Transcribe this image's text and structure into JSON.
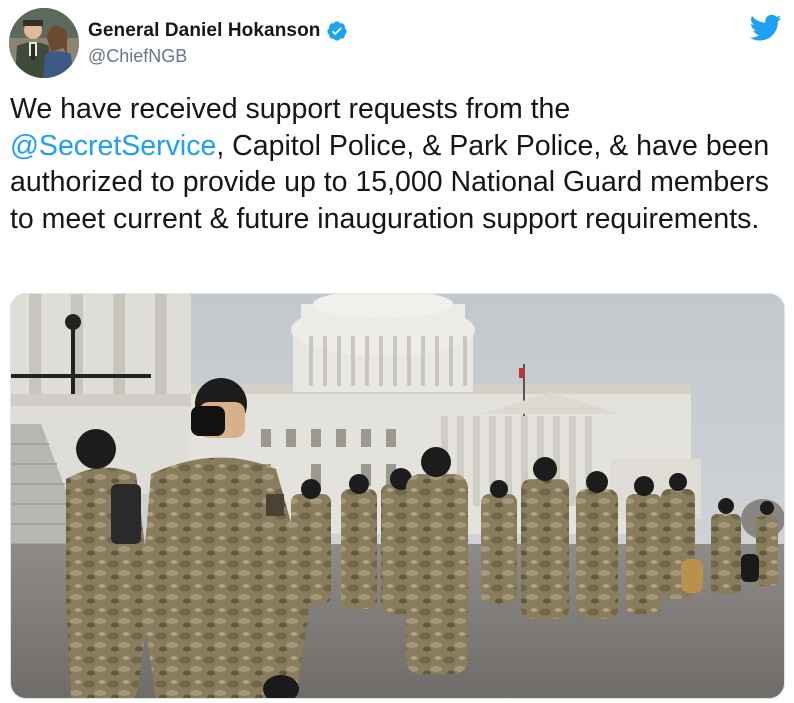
{
  "author": {
    "display_name": "General Daniel Hokanson",
    "handle": "@ChiefNGB",
    "verified": true,
    "avatar_icon": "avatar-photo"
  },
  "platform_icon": "twitter-bird-icon",
  "colors": {
    "link": "#1da1f2",
    "text": "#14171a",
    "secondary": "#657786",
    "verified_badge": "#1da1f2"
  },
  "tweet": {
    "text_before": "We have received support requests from the ",
    "mention": "@SecretService",
    "text_after": ", Capitol Police, & Park Police, & have been authorized to provide up to 15,000 National Guard members to meet current & future inauguration support requirements."
  },
  "media": {
    "type": "photo"
  }
}
